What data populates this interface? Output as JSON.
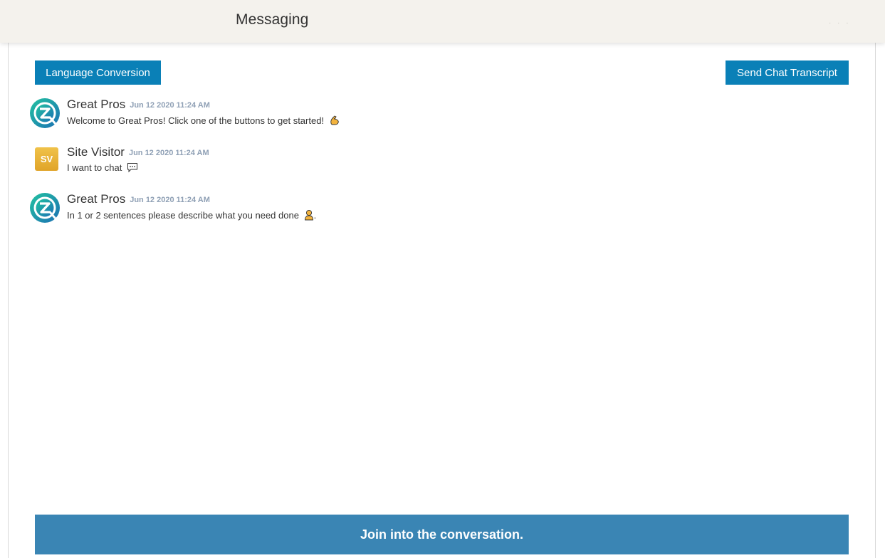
{
  "header": {
    "title": "Messaging",
    "menu_dots": "· · ·"
  },
  "toolbar": {
    "language_button": "Language Conversion",
    "transcript_button": "Send Chat Transcript"
  },
  "messages": [
    {
      "sender": "Great Pros",
      "timestamp": "Jun 12 2020 11:24 AM",
      "text": "Welcome to Great Pros! Click one of the buttons to get started!",
      "emoji": "flexed-biceps-emoji",
      "avatar": "great-pros-logo"
    },
    {
      "sender": "Site Visitor",
      "timestamp": "Jun 12 2020 11:24 AM",
      "text": "I want to chat",
      "emoji": "speech-bubble-emoji",
      "avatar": "initials",
      "initials": "SV"
    },
    {
      "sender": "Great Pros",
      "timestamp": "Jun 12 2020 11:24 AM",
      "text": "In 1 or 2 sentences please describe what you need done",
      "emoji": "person-emoji",
      "trailing": ".",
      "avatar": "great-pros-logo"
    }
  ],
  "footer": {
    "join_label": "Join into the conversation."
  },
  "colors": {
    "primary_button": "#0a80b7",
    "join_bar": "#3a85b4",
    "header_bg": "#f4f2ed",
    "timestamp": "#8fa0b5",
    "visitor_avatar": "#e8b33a",
    "logo_teal": "#1bb3a6",
    "logo_blue": "#1c6fb4"
  }
}
